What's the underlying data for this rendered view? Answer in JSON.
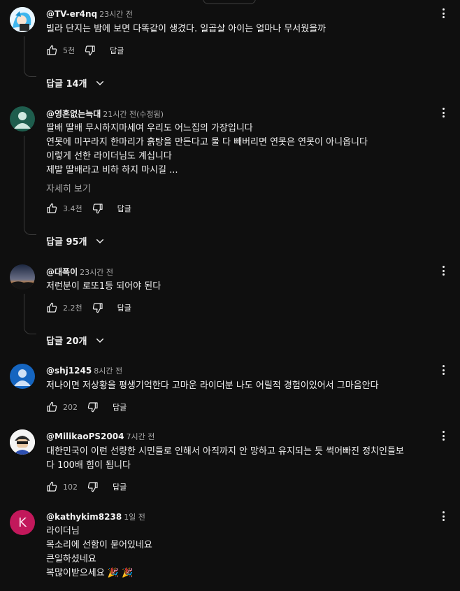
{
  "comments": [
    {
      "author": "@TV-er4nq",
      "time": "23시간 전",
      "lines": [
        "빌라 단지는 밤에 보면 다똑같이 생겼다.  일곱살 아이는 얼마나 무서웠을까"
      ],
      "likes": "5천",
      "reply_label": "답글",
      "replies_label": "답글 14개",
      "avatar_icon": "cartoon-avatar-icon"
    },
    {
      "author": "@영혼없는늑대",
      "time": "21시간 전(수정됨)",
      "lines": [
        "딸배 딸배  무시하지마세여    우리도  어느집의 가장입니다",
        "연못에 미꾸라지 한마리가 흙탕을 만든다고  물 다 빼버리면 연못은 연못이 아니옵니다",
        "이렇게 선한 라이더님도 계십니다",
        "제발   딸배라고 비하 하지 마시길  ..."
      ],
      "more_label": "자세히 보기",
      "likes": "3.4천",
      "reply_label": "답글",
      "replies_label": "답글 95개",
      "avatar_icon": "default-user-icon"
    },
    {
      "author": "@대폭이",
      "time": "23시간 전",
      "lines": [
        "저런분이 로또1등 되어야 된다"
      ],
      "likes": "2.2천",
      "reply_label": "답글",
      "replies_label": "답글 20개",
      "avatar_icon": "sunset-photo-avatar"
    },
    {
      "author": "@shj1245",
      "time": "8시간 전",
      "lines": [
        "저나이면 저상황을 평생기억한다 고마운 라이더분 나도 어릴적 경험이있어서 그마음안다"
      ],
      "likes": "202",
      "reply_label": "답글",
      "avatar_icon": "default-user-icon"
    },
    {
      "author": "@MilikaoPS2004",
      "time": "7시간 전",
      "lines": [
        "대한민국이 이런 선량한 시민들로 인해서 아직까지 안 망하고 유지되는 듯 썩어빠진 정치인들보",
        "다 100배 힘이 됩니다"
      ],
      "likes": "102",
      "reply_label": "답글",
      "avatar_icon": "cartoon-avatar-icon"
    },
    {
      "author": "@kathykim8238",
      "time": "1일 전",
      "lines": [
        "라이더님",
        "목소리에 선함이 묻어있네요",
        "큰일하셨네요",
        "복많이받으세요 🎉 🎉"
      ],
      "avatar_letter": "K",
      "avatar_icon": "letter-avatar",
      "colors": {
        "avatar_bg": "#c2185b"
      }
    }
  ],
  "colors": {
    "background": "#0f0f0f",
    "text": "#f1f1f1",
    "secondary": "#aaaaaa",
    "default_avatar_bg": "#1e5d4d",
    "default_avatar_bg2": "#1565c0"
  }
}
